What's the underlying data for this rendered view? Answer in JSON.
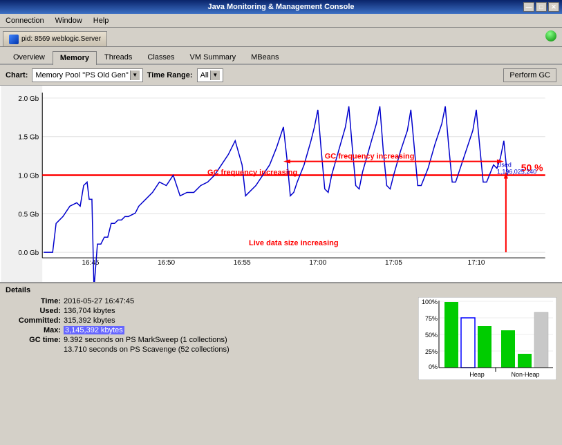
{
  "window": {
    "title": "Java Monitoring & Management Console",
    "title_buttons": [
      "—",
      "□",
      "✕"
    ]
  },
  "menu": {
    "items": [
      "Connection",
      "Window",
      "Help"
    ]
  },
  "connection_tab": {
    "label": "pid: 8569 weblogic.Server"
  },
  "nav": {
    "tabs": [
      "Overview",
      "Memory",
      "Threads",
      "Classes",
      "VM Summary",
      "MBeans"
    ],
    "active": "Memory"
  },
  "toolbar": {
    "chart_label": "Chart:",
    "chart_value": "Memory Pool \"PS Old Gen\"",
    "time_range_label": "Time Range:",
    "time_range_value": "All",
    "perform_gc": "Perform GC"
  },
  "chart": {
    "y_labels": [
      "2.0 Gb",
      "1.5 Gb",
      "1.0 Gb",
      "0.5 Gb",
      "0.0 Gb"
    ],
    "x_labels": [
      "16:45",
      "16:50",
      "16:55",
      "17:00",
      "17:05",
      "17:10"
    ],
    "annotation_gc": "GC frequency increasing",
    "annotation_live": "Live data size increasing",
    "annotation_50": "50 %",
    "used_label": "Used",
    "used_value": "1,196,025,240"
  },
  "details": {
    "header": "Details",
    "rows": [
      {
        "label": "Time:",
        "value": "2016-05-27 16:47:45",
        "highlight": false
      },
      {
        "label": "Used:",
        "value": "136,704 kbytes",
        "highlight": false
      },
      {
        "label": "Committed:",
        "value": "315,392 kbytes",
        "highlight": false
      },
      {
        "label": "Max:",
        "value": "3,145,392 kbytes",
        "highlight": true
      },
      {
        "label": "GC time:",
        "value": "9.392  seconds on PS MarkSweep (1 collections)",
        "highlight": false
      },
      {
        "label": "",
        "value": "13.710  seconds on PS Scavenge (52 collections)",
        "highlight": false,
        "indent": true
      }
    ]
  },
  "bar_chart": {
    "y_labels": [
      "100%",
      "75%",
      "50%",
      "25%",
      "0%"
    ],
    "groups": [
      {
        "label": "Heap",
        "bars": [
          {
            "color": "#00cc00",
            "height_pct": 95
          },
          {
            "color": "#0000ff",
            "height_pct": 75,
            "outlined": true
          },
          {
            "color": "#00cc00",
            "height_pct": 60
          }
        ]
      },
      {
        "label": "Non-Heap",
        "bars": [
          {
            "color": "#00cc00",
            "height_pct": 55
          },
          {
            "color": "#00cc00",
            "height_pct": 20
          },
          {
            "color": "#e0e0e0",
            "height_pct": 80
          }
        ]
      }
    ]
  }
}
